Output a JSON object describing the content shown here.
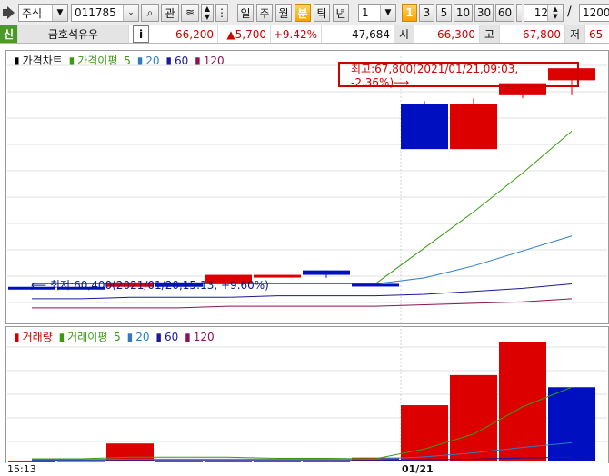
{
  "toolbar": {
    "market_select": "주식",
    "code_value": "011785",
    "interest_label": "관",
    "period_buttons": [
      "일",
      "주",
      "월",
      "분",
      "틱",
      "년"
    ],
    "active_period": "분",
    "interval_value": "1",
    "interval_buttons": [
      "1",
      "3",
      "5",
      "10",
      "30",
      "60"
    ],
    "active_interval": "1",
    "count_value": "12",
    "separator": "/",
    "total_value": "1200"
  },
  "infobar": {
    "new_badge": "신",
    "stock_name": "금호석유우",
    "info_button": "i",
    "price": "66,200",
    "change": "▲5,700",
    "change_pct": "+9.42%",
    "volume": "47,684",
    "open_label": "시",
    "open_value": "66,300",
    "high_label": "고",
    "high_value": "67,800",
    "low_label": "저",
    "low_value": "65"
  },
  "price_legend": {
    "title": "가격차트",
    "ma_label": "가격이평",
    "ma5": "5",
    "ma20": "20",
    "ma60": "60",
    "ma120": "120"
  },
  "volume_legend": {
    "title": "거래량",
    "ma_label": "거래이평",
    "ma5": "5",
    "ma20": "20",
    "ma60": "60",
    "ma120": "120"
  },
  "annotations": {
    "high": "최고:67,800(2021/01/21,09:03, -2.36%)⟶",
    "low": "⟵ 최저:60,400(2021/01/20,15:13, +9.60%)"
  },
  "x_axis": {
    "left_label": "15:13",
    "date_label": "01/21"
  },
  "colors": {
    "up": "#dd0000",
    "down": "#0010c0",
    "ma5": "#3a9a10",
    "ma20": "#2a7cc8",
    "ma60": "#1a1a9a",
    "ma120": "#8a1550"
  },
  "chart_data": {
    "type": "bar",
    "candles": [
      {
        "open": 60500,
        "close": 60500,
        "high": 60500,
        "low": 60400,
        "dir": "down"
      },
      {
        "open": 60500,
        "close": 60500,
        "high": 60500,
        "low": 60500,
        "dir": "down"
      },
      {
        "open": 60500,
        "close": 60650,
        "high": 60650,
        "low": 60500,
        "dir": "up"
      },
      {
        "open": 60650,
        "close": 60500,
        "high": 60650,
        "low": 60500,
        "dir": "down"
      },
      {
        "open": 60600,
        "close": 60900,
        "high": 60900,
        "low": 60600,
        "dir": "up"
      },
      {
        "open": 60900,
        "close": 60900,
        "high": 60900,
        "low": 60900,
        "dir": "up"
      },
      {
        "open": 61050,
        "close": 60900,
        "high": 61050,
        "low": 60800,
        "dir": "down"
      },
      {
        "open": 60600,
        "close": 60600,
        "high": 60600,
        "low": 60600,
        "dir": "down"
      },
      {
        "open": 66600,
        "close": 65100,
        "high": 66700,
        "low": 65100,
        "dir": "down"
      },
      {
        "open": 65100,
        "close": 66600,
        "high": 66800,
        "low": 65100,
        "dir": "up"
      },
      {
        "open": 66900,
        "close": 67300,
        "high": 67300,
        "low": 66800,
        "dir": "up"
      },
      {
        "open": 67400,
        "close": 67800,
        "high": 67800,
        "low": 66900,
        "dir": "up"
      }
    ],
    "ma5": [
      60600,
      60600,
      60600,
      60600,
      60600,
      60600,
      60600,
      60600,
      61800,
      63000,
      64300,
      65700
    ],
    "ma20": [
      60600,
      60600,
      60600,
      60600,
      60600,
      60600,
      60600,
      60600,
      60800,
      61200,
      61700,
      62200
    ],
    "ma60": [
      60100,
      60100,
      60150,
      60150,
      60150,
      60200,
      60200,
      60200,
      60250,
      60350,
      60450,
      60600
    ],
    "ma120": [
      59800,
      59800,
      59800,
      59800,
      59850,
      59850,
      59850,
      59850,
      59900,
      59950,
      60000,
      60100
    ],
    "volume": [
      250,
      350,
      4600,
      300,
      300,
      300,
      300,
      1000,
      14400,
      22100,
      30500,
      19000
    ],
    "volume_dir": [
      "up",
      "down",
      "up",
      "down",
      "down",
      "down",
      "down",
      "up",
      "up",
      "up",
      "up",
      "down"
    ],
    "vol_ma5": [
      700,
      700,
      1100,
      1100,
      1100,
      800,
      800,
      700,
      3200,
      7000,
      14000,
      19000
    ],
    "vol_ma20": [
      500,
      500,
      600,
      600,
      600,
      600,
      600,
      600,
      1200,
      2200,
      3600,
      4800
    ],
    "vol_ma60": [
      300,
      300,
      300,
      300,
      300,
      300,
      300,
      300,
      400,
      600,
      900,
      1100
    ]
  }
}
